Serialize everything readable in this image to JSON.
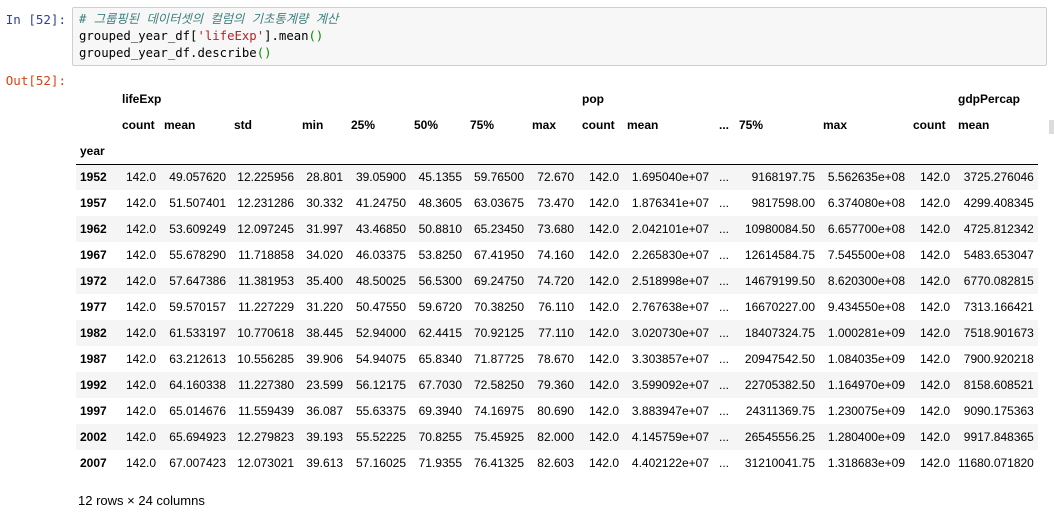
{
  "cell": {
    "in_prompt": "In [52]:",
    "out_prompt": "Out[52]:",
    "code": {
      "comment": "# 그룹핑된 데이터셋의 컬럼의 기초통계량 계산",
      "line2_a": "grouped_year_df[",
      "line2_str": "'lifeExp'",
      "line2_b": "].mean",
      "line2_paren": "()",
      "line3_a": "grouped_year_df.describe",
      "line3_paren": "()"
    }
  },
  "table": {
    "groups": [
      "lifeExp",
      "pop",
      "gdpPercap"
    ],
    "columns": [
      "count",
      "mean",
      "std",
      "min",
      "25%",
      "50%",
      "75%",
      "max",
      "count",
      "mean",
      "...",
      "75%",
      "max",
      "count",
      "mean"
    ],
    "index_name": "year",
    "rows": [
      {
        "year": "1952",
        "cells": [
          "142.0",
          "49.057620",
          "12.225956",
          "28.801",
          "39.05900",
          "45.1355",
          "59.76500",
          "72.670",
          "142.0",
          "1.695040e+07",
          "...",
          "9168197.75",
          "5.562635e+08",
          "142.0",
          "3725.276046"
        ]
      },
      {
        "year": "1957",
        "cells": [
          "142.0",
          "51.507401",
          "12.231286",
          "30.332",
          "41.24750",
          "48.3605",
          "63.03675",
          "73.470",
          "142.0",
          "1.876341e+07",
          "...",
          "9817598.00",
          "6.374080e+08",
          "142.0",
          "4299.408345"
        ]
      },
      {
        "year": "1962",
        "cells": [
          "142.0",
          "53.609249",
          "12.097245",
          "31.997",
          "43.46850",
          "50.8810",
          "65.23450",
          "73.680",
          "142.0",
          "2.042101e+07",
          "...",
          "10980084.50",
          "6.657700e+08",
          "142.0",
          "4725.812342"
        ]
      },
      {
        "year": "1967",
        "cells": [
          "142.0",
          "55.678290",
          "11.718858",
          "34.020",
          "46.03375",
          "53.8250",
          "67.41950",
          "74.160",
          "142.0",
          "2.265830e+07",
          "...",
          "12614584.75",
          "7.545500e+08",
          "142.0",
          "5483.653047"
        ]
      },
      {
        "year": "1972",
        "cells": [
          "142.0",
          "57.647386",
          "11.381953",
          "35.400",
          "48.50025",
          "56.5300",
          "69.24750",
          "74.720",
          "142.0",
          "2.518998e+07",
          "...",
          "14679199.50",
          "8.620300e+08",
          "142.0",
          "6770.082815"
        ]
      },
      {
        "year": "1977",
        "cells": [
          "142.0",
          "59.570157",
          "11.227229",
          "31.220",
          "50.47550",
          "59.6720",
          "70.38250",
          "76.110",
          "142.0",
          "2.767638e+07",
          "...",
          "16670227.00",
          "9.434550e+08",
          "142.0",
          "7313.166421"
        ]
      },
      {
        "year": "1982",
        "cells": [
          "142.0",
          "61.533197",
          "10.770618",
          "38.445",
          "52.94000",
          "62.4415",
          "70.92125",
          "77.110",
          "142.0",
          "3.020730e+07",
          "...",
          "18407324.75",
          "1.000281e+09",
          "142.0",
          "7518.901673"
        ]
      },
      {
        "year": "1987",
        "cells": [
          "142.0",
          "63.212613",
          "10.556285",
          "39.906",
          "54.94075",
          "65.8340",
          "71.87725",
          "78.670",
          "142.0",
          "3.303857e+07",
          "...",
          "20947542.50",
          "1.084035e+09",
          "142.0",
          "7900.920218"
        ]
      },
      {
        "year": "1992",
        "cells": [
          "142.0",
          "64.160338",
          "11.227380",
          "23.599",
          "56.12175",
          "67.7030",
          "72.58250",
          "79.360",
          "142.0",
          "3.599092e+07",
          "...",
          "22705382.50",
          "1.164970e+09",
          "142.0",
          "8158.608521"
        ]
      },
      {
        "year": "1997",
        "cells": [
          "142.0",
          "65.014676",
          "11.559439",
          "36.087",
          "55.63375",
          "69.3940",
          "74.16975",
          "80.690",
          "142.0",
          "3.883947e+07",
          "...",
          "24311369.75",
          "1.230075e+09",
          "142.0",
          "9090.175363"
        ]
      },
      {
        "year": "2002",
        "cells": [
          "142.0",
          "65.694923",
          "12.279823",
          "39.193",
          "55.52225",
          "70.8255",
          "75.45925",
          "82.000",
          "142.0",
          "4.145759e+07",
          "...",
          "26545556.25",
          "1.280400e+09",
          "142.0",
          "9917.848365"
        ]
      },
      {
        "year": "2007",
        "cells": [
          "142.0",
          "67.007423",
          "12.073021",
          "39.613",
          "57.16025",
          "71.9355",
          "76.41325",
          "82.603",
          "142.0",
          "4.402122e+07",
          "...",
          "31210041.75",
          "1.318683e+09",
          "142.0",
          "11680.071820"
        ]
      }
    ],
    "shape": "12 rows × 24 columns"
  }
}
